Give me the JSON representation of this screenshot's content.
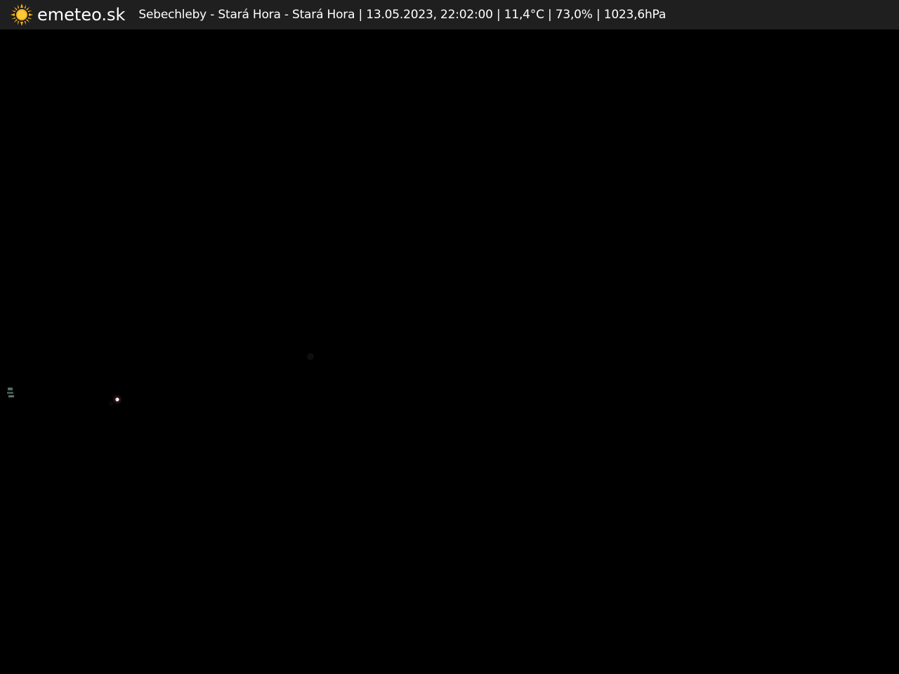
{
  "header": {
    "logo_icon": "sun-icon",
    "brand": "emeteo.sk",
    "location": "Sebechleby - Stará Hora - Stará Hora",
    "datetime": "13.05.2023, 22:02:00",
    "temperature": "11,4°C",
    "humidity": "73,0%",
    "pressure": "1023,6hPa",
    "separator": "|",
    "colors": {
      "bar": "#1f1f1f",
      "text": "#ffffff",
      "sun": "#f5b21b"
    }
  },
  "image": {
    "description_colors": {
      "sky": "#000000"
    }
  }
}
